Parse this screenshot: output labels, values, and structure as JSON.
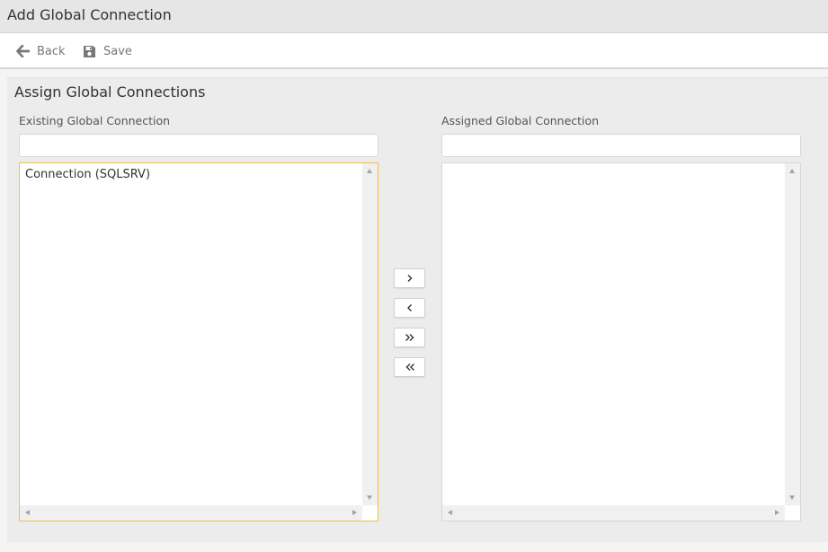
{
  "window": {
    "title": "Add Global Connection"
  },
  "toolbar": {
    "back_label": "Back",
    "save_label": "Save"
  },
  "section": {
    "title": "Assign Global Connections"
  },
  "existing": {
    "label": "Existing Global Connection",
    "filter_value": "",
    "items": [
      "Connection (SQLSRV)"
    ]
  },
  "assigned": {
    "label": "Assigned Global Connection",
    "filter_value": "",
    "items": []
  },
  "move_buttons": {
    "move_right_icon": "chevron-right-icon",
    "move_left_icon": "chevron-left-icon",
    "move_all_right_icon": "double-chevron-right-icon",
    "move_all_left_icon": "double-chevron-left-icon"
  },
  "colors": {
    "focus_border": "#f0c040",
    "titlebar_bg": "#e6e6e6",
    "panel_bg": "#ececec"
  }
}
